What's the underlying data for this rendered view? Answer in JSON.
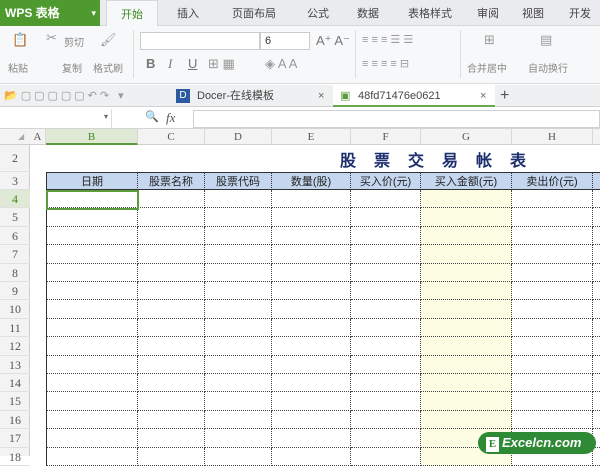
{
  "app": {
    "logo": "WPS 表格",
    "logo_icon": "wps-s"
  },
  "menu_tabs": [
    "开始",
    "插入",
    "页面布局",
    "公式",
    "数据",
    "表格样式",
    "审阅",
    "视图",
    "开发"
  ],
  "ribbon": {
    "paste": "粘贴",
    "cut": "剪切",
    "copy": "复制",
    "format_painter": "格式刷",
    "font_size": "6",
    "bold": "B",
    "italic": "I",
    "underline": "U",
    "merge_center": "合并居中",
    "wrap_text": "自动换行"
  },
  "doc_tabs": [
    {
      "label": "Docer-在线模板"
    },
    {
      "label": "48fd71476e0621"
    }
  ],
  "formula_bar": {
    "fx": "fx",
    "name_box": "",
    "value": ""
  },
  "columns": [
    "A",
    "B",
    "C",
    "D",
    "E",
    "F",
    "G",
    "H"
  ],
  "selected_column": "B",
  "row_numbers": [
    "2",
    "3",
    "4",
    "5",
    "6",
    "7",
    "8",
    "9",
    "10",
    "11",
    "12",
    "13",
    "14",
    "15",
    "16",
    "17",
    "18"
  ],
  "selected_row": "4",
  "sheet": {
    "title": "股票交易帐表",
    "headers": [
      "日期",
      "股票名称",
      "股票代码",
      "数量(股)",
      "买入价(元)",
      "买入金额(元)",
      "卖出价(元)"
    ]
  },
  "watermark": "Excelcn.com",
  "colors": {
    "accent": "#4e9a2f",
    "header_fill": "#c5d6ef",
    "highlight_col": "#fdfde3",
    "title": "#1c2f6e"
  }
}
